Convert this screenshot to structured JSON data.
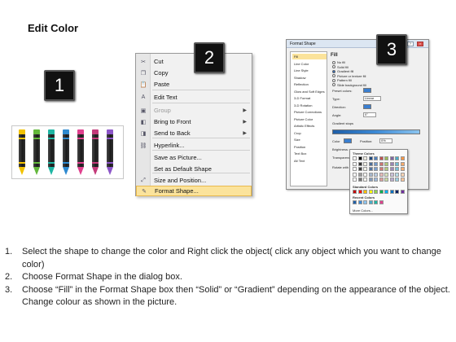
{
  "title": "Edit Color",
  "badges": [
    "1",
    "2",
    "3"
  ],
  "crayons": {
    "colors": [
      "#f2c200",
      "#64b83c",
      "#1fb6a4",
      "#2e8ad0",
      "#e0408e",
      "#c33a7a",
      "#8c55c8"
    ]
  },
  "context_menu": {
    "items": [
      {
        "label": "Cut",
        "icon": "scissors-icon",
        "glyph": "✂",
        "disabled": false,
        "submenu": false,
        "highlighted": false
      },
      {
        "label": "Copy",
        "icon": "copy-icon",
        "glyph": "❐",
        "disabled": false,
        "submenu": false,
        "highlighted": false
      },
      {
        "label": "Paste",
        "icon": "paste-icon",
        "glyph": "📋",
        "disabled": false,
        "submenu": false,
        "highlighted": false
      },
      {
        "label": "Edit Text",
        "icon": "edit-text-icon",
        "glyph": "A",
        "disabled": false,
        "submenu": false,
        "highlighted": false
      },
      {
        "label": "Group",
        "icon": "group-icon",
        "glyph": "▣",
        "disabled": true,
        "submenu": true,
        "highlighted": false
      },
      {
        "label": "Bring to Front",
        "icon": "bring-to-front-icon",
        "glyph": "◧",
        "disabled": false,
        "submenu": true,
        "highlighted": false
      },
      {
        "label": "Send to Back",
        "icon": "send-to-back-icon",
        "glyph": "◨",
        "disabled": false,
        "submenu": true,
        "highlighted": false
      },
      {
        "label": "Hyperlink...",
        "icon": "hyperlink-icon",
        "glyph": "⛓",
        "disabled": false,
        "submenu": false,
        "highlighted": false
      },
      {
        "label": "Save as Picture...",
        "icon": "",
        "glyph": "",
        "disabled": false,
        "submenu": false,
        "highlighted": false
      },
      {
        "label": "Set as Default Shape",
        "icon": "",
        "glyph": "",
        "disabled": false,
        "submenu": false,
        "highlighted": false
      },
      {
        "label": "Size and Position...",
        "icon": "size-position-icon",
        "glyph": "⤢",
        "disabled": false,
        "submenu": false,
        "highlighted": false
      },
      {
        "label": "Format Shape...",
        "icon": "format-shape-icon",
        "glyph": "✎",
        "disabled": false,
        "submenu": false,
        "highlighted": true
      }
    ]
  },
  "format_dialog": {
    "title": "Format Shape",
    "nav": [
      "Fill",
      "Line Color",
      "Line Style",
      "Shadow",
      "Reflection",
      "Glow and Soft Edges",
      "3-D Format",
      "3-D Rotation",
      "Picture Corrections",
      "Picture Color",
      "Artistic Effects",
      "Crop",
      "Size",
      "Position",
      "Text Box",
      "Alt Text"
    ],
    "section": "Fill",
    "fill_options": [
      {
        "label": "No fill",
        "selected": false
      },
      {
        "label": "Solid fill",
        "selected": false
      },
      {
        "label": "Gradient fill",
        "selected": true
      },
      {
        "label": "Picture or texture fill",
        "selected": false
      },
      {
        "label": "Pattern fill",
        "selected": false
      },
      {
        "label": "Slide background fill",
        "selected": false
      }
    ],
    "fields": {
      "preset_label": "Preset colors:",
      "type_label": "Type:",
      "type_value": "Linear",
      "direction_label": "Direction:",
      "angle_label": "Angle:",
      "angle_value": "0°",
      "stops_label": "Gradient stops",
      "color_label": "Color",
      "position_label": "Position:",
      "position_value": "0%",
      "brightness_label": "Brightness:",
      "transparency_label": "Transparency:",
      "rotate_label": "Rotate with shape"
    }
  },
  "color_popup": {
    "theme_heading": "Theme Colors",
    "standard_heading": "Standard Colors",
    "recent_heading": "Recent Colors",
    "more_label": "More Colors...",
    "theme_row": [
      "#ffffff",
      "#000000",
      "#eeece1",
      "#1f497d",
      "#4f81bd",
      "#c0504d",
      "#9bbb59",
      "#8064a2",
      "#4bacc6",
      "#f79646"
    ],
    "standard_row": [
      "#c00000",
      "#ff0000",
      "#ffc000",
      "#ffff00",
      "#92d050",
      "#00b050",
      "#00b0f0",
      "#0070c0",
      "#002060",
      "#7030a0"
    ],
    "recent_row": [
      "#1f5fa8",
      "#3c8ad6",
      "#8cc5f0",
      "#4bacc6",
      "#1fb6a4",
      "#e0408e"
    ]
  },
  "instructions": [
    {
      "num": "1.",
      "text": "Select the shape to change the color and Right click the object( click any object which you want to change color)"
    },
    {
      "num": "2.",
      "text": "Choose Format Shape in the dialog box."
    },
    {
      "num": "3.",
      "text": "Choose “Fill” in the Format Shape box then “Solid” or “Gradient” depending on the appearance of the object. Change colour as shown in the picture."
    }
  ]
}
